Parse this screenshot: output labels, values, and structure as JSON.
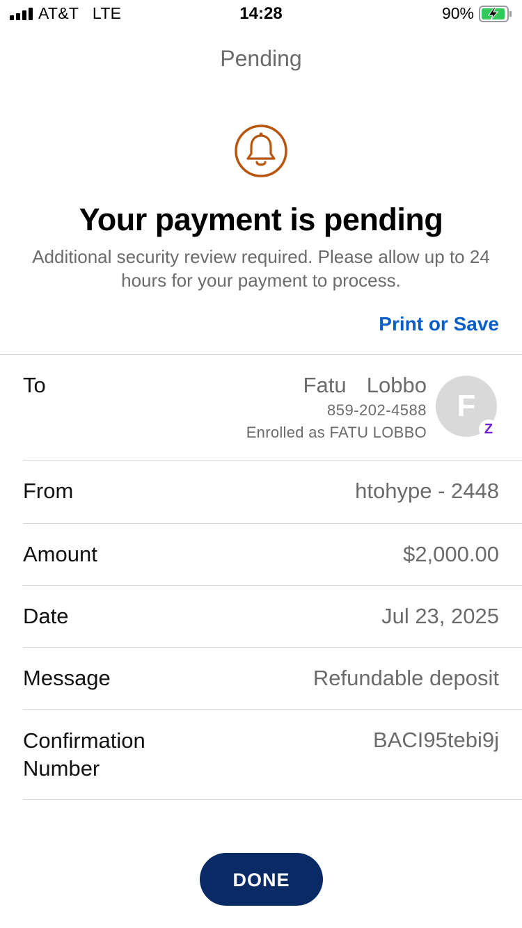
{
  "status_bar": {
    "carrier": "AT&T   LTE",
    "time": "14:28",
    "battery_percent": "90%",
    "battery_level": 0.9
  },
  "nav": {
    "title": "Pending"
  },
  "header": {
    "icon": "bell-icon",
    "headline": "Your payment is pending",
    "subtext": "Additional security review required. Please allow up to 24 hours for your payment to process.",
    "print_link": "Print or Save"
  },
  "details": {
    "to": {
      "label": "To",
      "name": "Fatu  Lobbo",
      "phone": "859-202-4588",
      "enrolled": "Enrolled as FATU LOBBO",
      "avatar_initial": "F",
      "badge_glyph": "Z"
    },
    "from": {
      "label": "From",
      "value": "htohype - 2448"
    },
    "amount": {
      "label": "Amount",
      "value": "$2,000.00"
    },
    "date": {
      "label": "Date",
      "value": "Jul 23, 2025"
    },
    "message": {
      "label": "Message",
      "value": "Refundable deposit"
    },
    "confirmation": {
      "label": "Confirmation Number",
      "value": "BACI95tebi9j"
    }
  },
  "done_button": "DONE",
  "colors": {
    "accent_link": "#0a5ec8",
    "bell": "#b8560f",
    "button": "#0a2a66",
    "zelle": "#6d1ed4"
  }
}
